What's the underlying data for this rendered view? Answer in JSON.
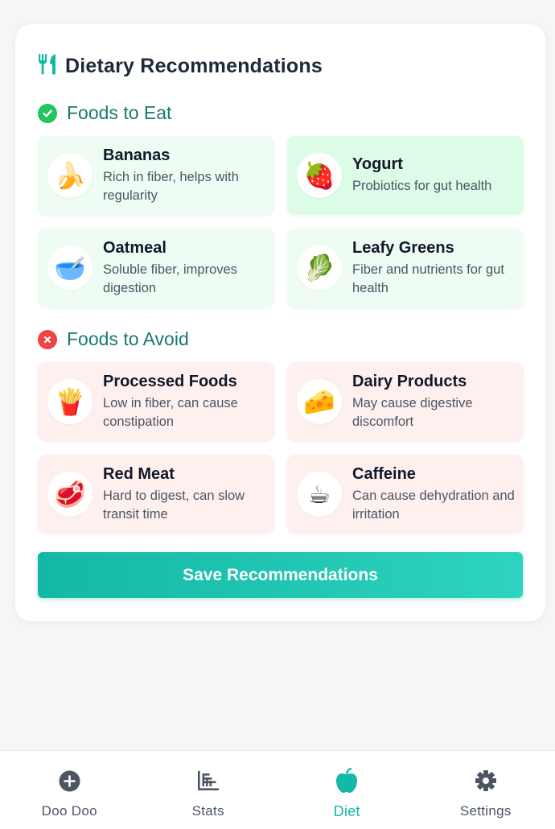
{
  "card": {
    "title": "Dietary Recommendations",
    "title_icon": "utensils-icon"
  },
  "eat": {
    "heading": "Foods to Eat",
    "items": [
      {
        "name": "Bananas",
        "desc": "Rich in fiber, helps with regularity",
        "icon": "🍌"
      },
      {
        "name": "Yogurt",
        "desc": "Probiotics for gut health",
        "icon": "🍓"
      },
      {
        "name": "Oatmeal",
        "desc": "Soluble fiber, improves digestion",
        "icon": "🥣"
      },
      {
        "name": "Leafy Greens",
        "desc": "Fiber and nutrients for gut health",
        "icon": "🥬"
      }
    ]
  },
  "avoid": {
    "heading": "Foods to Avoid",
    "items": [
      {
        "name": "Processed Foods",
        "desc": "Low in fiber, can cause constipation",
        "icon": "🍟"
      },
      {
        "name": "Dairy Products",
        "desc": "May cause digestive discomfort",
        "icon": "🧀"
      },
      {
        "name": "Red Meat",
        "desc": "Hard to digest, can slow transit time",
        "icon": "🥩"
      },
      {
        "name": "Caffeine",
        "desc": "Can cause dehydration and irritation",
        "icon": "☕"
      }
    ]
  },
  "save_label": "Save Recommendations",
  "tabs": [
    {
      "label": "Doo Doo",
      "icon": "plus-circle-icon"
    },
    {
      "label": "Stats",
      "icon": "chart-bars-icon"
    },
    {
      "label": "Diet",
      "icon": "apple-icon",
      "active": true
    },
    {
      "label": "Settings",
      "icon": "gear-icon"
    }
  ],
  "colors": {
    "accent": "#14b8a6",
    "section_heading": "#197a6c",
    "eat_bg": "#eefcf3",
    "avoid_bg": "#fff0f0",
    "good": "#22c55e",
    "bad": "#ef4444"
  }
}
